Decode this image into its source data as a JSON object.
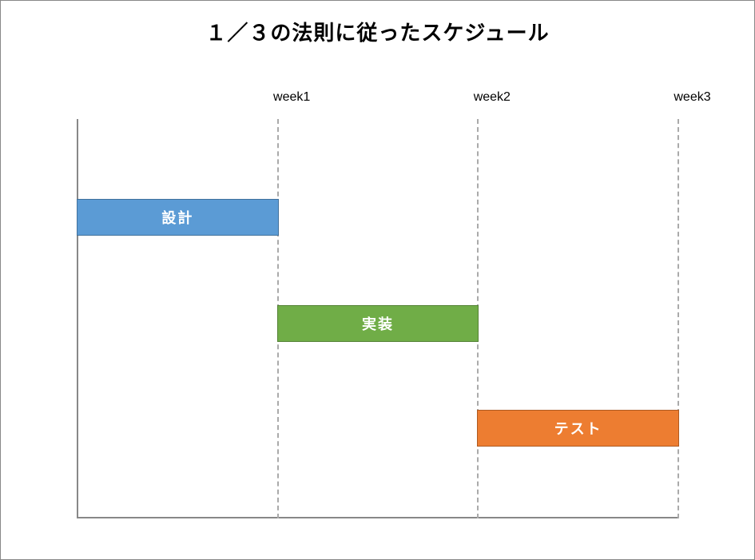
{
  "title": "１／３の法則に従ったスケジュール",
  "weeks": {
    "w1": "week1",
    "w2": "week2",
    "w3": "week3"
  },
  "bars": {
    "design": "設計",
    "implement": "実装",
    "test": "テスト"
  },
  "chart_data": {
    "type": "bar",
    "title": "１／３の法則に従ったスケジュール",
    "xlabel": "",
    "ylabel": "",
    "categories": [
      "設計",
      "実装",
      "テスト"
    ],
    "series": [
      {
        "name": "設計",
        "start": 0,
        "end": 1,
        "color": "#5b9bd5"
      },
      {
        "name": "実装",
        "start": 1,
        "end": 2,
        "color": "#70ad47"
      },
      {
        "name": "テスト",
        "start": 2,
        "end": 3,
        "color": "#ed7d31"
      }
    ],
    "x_ticks": [
      "week1",
      "week2",
      "week3"
    ],
    "xlim": [
      0,
      3
    ]
  }
}
